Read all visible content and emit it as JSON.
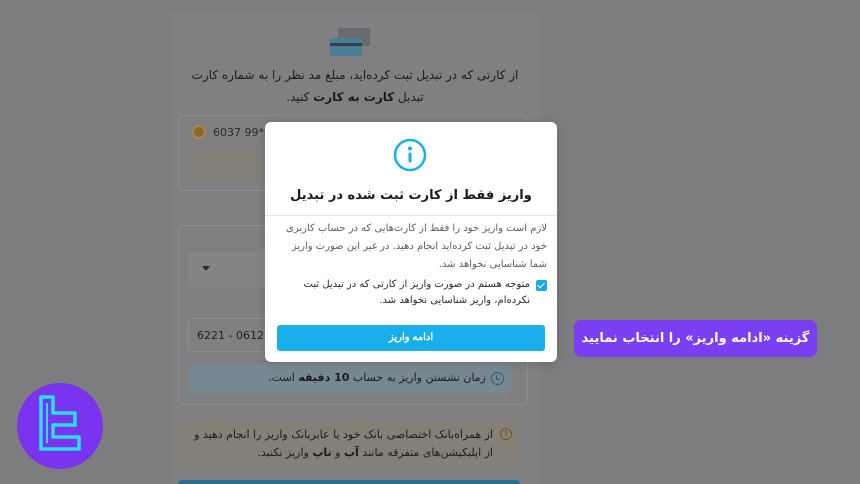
{
  "background": {
    "intro_text_part1": "از کارتی که در تبدیل ثبت کرده‌اید، مبلغ مد نظر را به شماره کارت تبدیل",
    "intro_text_bold": "کارت به کارت",
    "intro_text_part2": "کنید.",
    "card_number": "6037 99** *",
    "iban_value": "6221 - 0612 -",
    "time_prefix": "زمان نشستن واریز به حساب",
    "time_bold": "10 دقیقه",
    "time_suffix": "است.",
    "warning_part1": "از همراه‌بانک اختصاصی بانک خود یا عابربانک واریز را انجام دهید و از اپلیکیشن‌های متفرقه مانند",
    "warning_bold1": "آپ",
    "warning_and": "و",
    "warning_bold2": "تاپ",
    "warning_part2": "واریز نکنید."
  },
  "modal": {
    "icon": "info-icon",
    "title": "واریز فقط از کارت ثبت شده در تبدیل",
    "body": "لازم است واریز خود را فقط از کارت‌هایی که در حساب کاربری خود در تبدیل ثبت کرده‌اید انجام دهید. در غیر این صورت واریز شما شناسایی نخواهد شد.",
    "checkbox_label": "متوجه هستم در صورت واریز از کارتی که در تبدیل ثبت نکرده‌ام، واریز شناسایی نخواهد شد.",
    "checkbox_checked": true,
    "continue_label": "ادامه واریز"
  },
  "tooltip": {
    "text": "گزینه «ادامه واریز» را انتخاب نمایید"
  },
  "colors": {
    "accent": "#1aaeea",
    "tooltip": "#7b3ff2",
    "logo": "#7a33ee"
  }
}
